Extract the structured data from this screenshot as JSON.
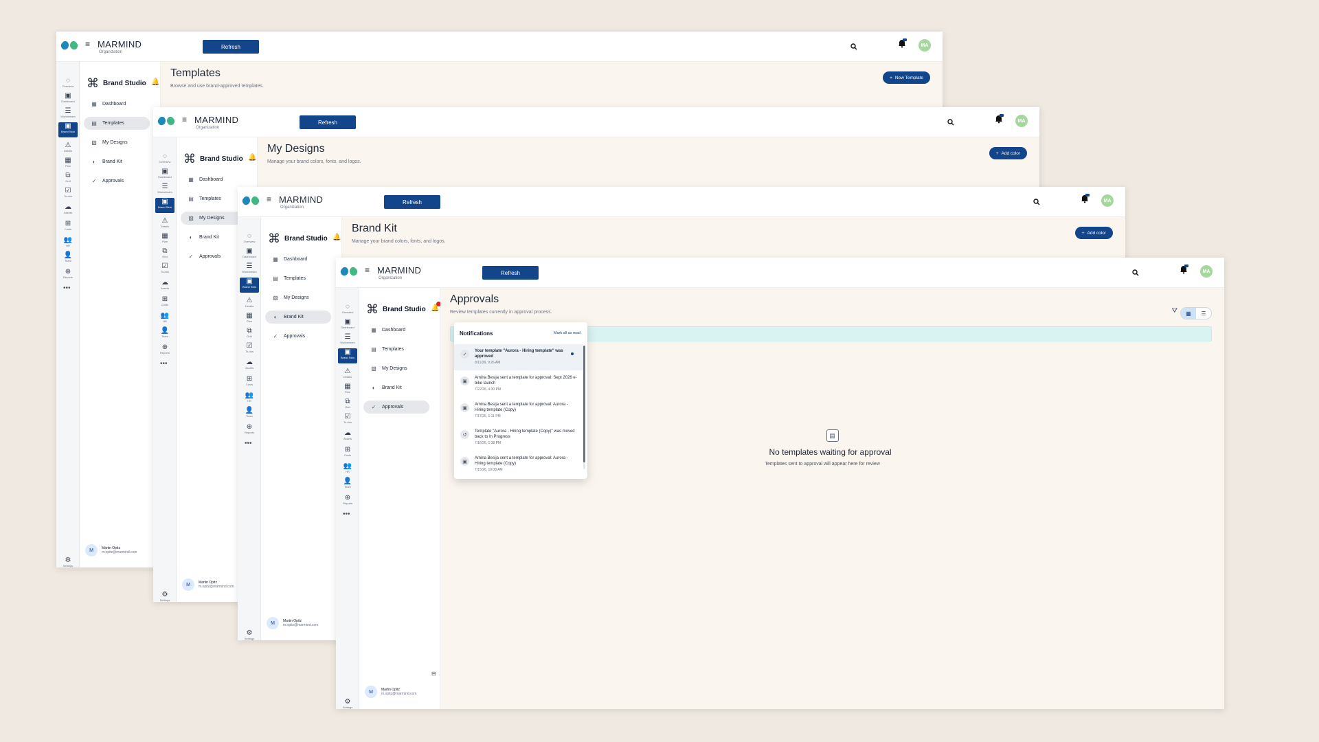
{
  "org": {
    "name": "MARMIND",
    "subtitle": "Organization",
    "refresh_label": "Refresh",
    "avatar_initials": "MA",
    "notif_badge": "10"
  },
  "rail": [
    {
      "label": "Overview",
      "icon": "overview-icon"
    },
    {
      "label": "Dashboard",
      "icon": "dashboard-icon"
    },
    {
      "label": "Workstream",
      "icon": "workstream-icon"
    },
    {
      "label": "Brand Stdo",
      "icon": "brand-studio-icon"
    },
    {
      "label": "Details",
      "icon": "details-icon"
    },
    {
      "label": "Plan",
      "icon": "plan-icon"
    },
    {
      "label": "Grid",
      "icon": "grid-icon"
    },
    {
      "label": "To-dos",
      "icon": "todos-icon"
    },
    {
      "label": "Assets",
      "icon": "assets-icon"
    },
    {
      "label": "Costs",
      "icon": "costs-icon"
    },
    {
      "label": "HR",
      "icon": "hr-icon"
    },
    {
      "label": "Team",
      "icon": "team-icon"
    },
    {
      "label": "Reports",
      "icon": "reports-icon"
    }
  ],
  "settings_label": "Settings",
  "brand": {
    "title": "Brand Studio",
    "nav": [
      "Dashboard",
      "Templates",
      "My Designs",
      "Brand Kit",
      "Approvals"
    ]
  },
  "user": {
    "initial": "M",
    "name": "Martin Opitz",
    "email": "m.opitz@marmind.com"
  },
  "windows": [
    {
      "title": "Templates",
      "subtitle": "Browse and use brand-approved templates.",
      "button": "New Template",
      "active_nav": 1
    },
    {
      "title": "My Designs",
      "subtitle": "Manage your brand colors, fonts, and logos.",
      "button": "Add color",
      "active_nav": 2
    },
    {
      "title": "Brand Kit",
      "subtitle": "Manage your brand colors, fonts, and logos.",
      "button": "Add color",
      "active_nav": 3
    },
    {
      "title": "Approvals",
      "subtitle": "Review templates currently in approval process.",
      "button": "",
      "active_nav": 4
    }
  ],
  "approvals": {
    "empty_title": "No templates waiting for approval",
    "empty_sub": "Templates sent to approval will appear here for review"
  },
  "notifications": {
    "title": "Notifications",
    "mark_all": "Mark all as read",
    "items": [
      {
        "text": "Your template \"Aurora - Hiring template\" was approved",
        "time": "8/11/26, 9:26 AM",
        "unread": true
      },
      {
        "text": "Amina Besija sent a template for approval: Sept 2026 e-bike launch",
        "time": "7/22/26, 4:30 PM",
        "unread": false
      },
      {
        "text": "Amina Besija sent a template for approval: Aurora - Hiring template (Copy)",
        "time": "7/17/26, 1:11 PM",
        "unread": false
      },
      {
        "text": "Template \"Aurora - Hiring template (Copy)\" was moved back to In Progress",
        "time": "7/16/26, 1:38 PM",
        "unread": false
      },
      {
        "text": "Amina Besija sent a template for approval: Aurora - Hiring template (Copy)",
        "time": "7/15/26, 10:08 AM",
        "unread": false
      }
    ]
  },
  "colors": {
    "primary": "#12458a",
    "content_bg": "#fbf5ef",
    "page_bg": "#efe9e1"
  }
}
